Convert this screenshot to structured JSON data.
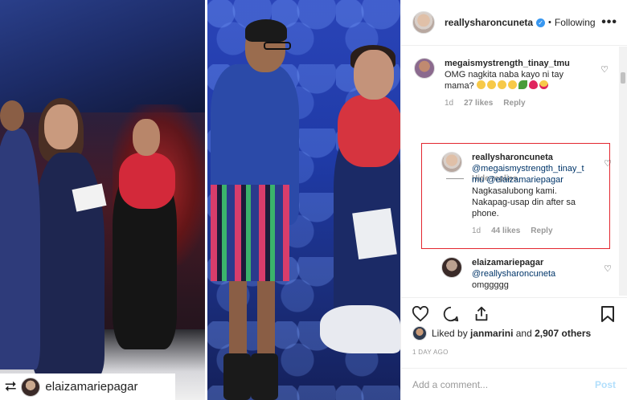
{
  "photo": {
    "repost_username": "elaizamariepagar"
  },
  "header": {
    "username": "reallysharoncuneta",
    "verified": "verified-badge",
    "separator": "•",
    "follow_status": "Following",
    "more": "•••"
  },
  "comments": [
    {
      "username": "megaismystrength_tinay_tmu",
      "text": "OMG nagkita naba kayo ni tay mama?",
      "emojis": [
        "grin",
        "grin",
        "grin",
        "grin",
        "leaf",
        "heart",
        "heart-eyes"
      ],
      "age": "1d",
      "likes": "27 likes",
      "reply": "Reply"
    },
    {
      "username": "reallysharoncuneta",
      "mention1": "@megaismystrength_tinay_tmu",
      "mention2": "@elaizamariepagar",
      "text": "Nagkasalubong kami. Nakapag-usap din after sa phone.",
      "age": "1d",
      "likes": "44 likes",
      "reply": "Reply"
    },
    {
      "username": "elaizamariepagar",
      "mention": "@reallysharoncuneta",
      "text": "omggggg"
    }
  ],
  "hide_replies": "Hide replies",
  "likes_line": {
    "prefix": "Liked by",
    "user": "janmarini",
    "joiner": "and",
    "count": "2,907 others"
  },
  "timestamp": "1 DAY AGO",
  "add_comment": {
    "placeholder": "Add a comment...",
    "post": "Post"
  },
  "colors": {
    "link": "#003569",
    "verified": "#3897f0",
    "highlight_box": "#e3262f",
    "post_disabled": "#b2dffc"
  }
}
